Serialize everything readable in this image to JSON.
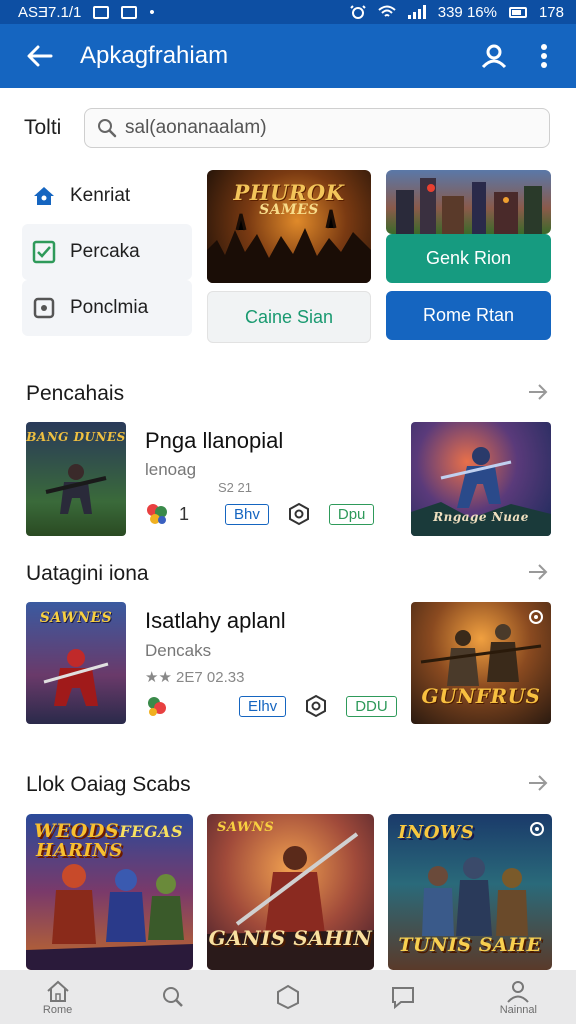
{
  "status": {
    "time": "ASƎ7.1/1",
    "right_text": "339 16%",
    "right_time": "178"
  },
  "appbar": {
    "title": "Apkagfrahiam",
    "back_icon": "arrow-left-icon",
    "account_icon": "account-icon",
    "more_icon": "more-vertical-icon"
  },
  "search": {
    "label": "Tolti",
    "value": "sal(aonanaalam)"
  },
  "menu": [
    {
      "label": "Kenriat",
      "icon": "home-icon"
    },
    {
      "label": "Percaka",
      "icon": "checkbox-icon"
    },
    {
      "label": "Ponclmia",
      "icon": "square-dot-icon"
    }
  ],
  "featured": {
    "banner_text_1": "PHUROK",
    "banner_text_2": "SAMES",
    "button_caine": "Caine Sian",
    "button_genk": "Genk Rion",
    "button_rome": "Rome Rtan"
  },
  "sections": {
    "s1": "Pencahais",
    "s2": "Uatagini iona",
    "s3": "Llok Oaiag Scabs"
  },
  "rows": [
    {
      "title": "Pnga llanopial",
      "subtitle": "lenoag",
      "extra": "S2 21",
      "count": "1",
      "chip1": "Bhv",
      "chip2": "Dpu",
      "thumb_text": "BANG DUNES",
      "big_text": "Rngage Nuae"
    },
    {
      "title": "Isatlahy  aplanl",
      "subtitle": "Dencaks",
      "extra": "★★ 2E7 02.33",
      "chip1": "Elhv",
      "chip2": "DDU",
      "thumb_text": "SAWNES",
      "big_text": "GUNFRUS"
    }
  ],
  "posters": [
    {
      "t1": "WEODS",
      "t2": "HARINS",
      "t3": "FEGAS"
    },
    {
      "t1": "SAWNS",
      "t2": "GANIS SAHIN"
    },
    {
      "t1": "INOWS",
      "t2": "TUNIS  SAHE"
    }
  ],
  "nav": [
    {
      "label": "Rome",
      "icon": "home-icon"
    },
    {
      "label": "",
      "icon": "search-icon"
    },
    {
      "label": "",
      "icon": "hexagon-icon"
    },
    {
      "label": "",
      "icon": "chat-icon"
    },
    {
      "label": "Nainnal",
      "icon": "profile-icon"
    }
  ],
  "colors": {
    "appbar": "#1565c0",
    "status": "#0d4fa3",
    "green_button": "#169b80",
    "blue_button": "#1565c0"
  }
}
